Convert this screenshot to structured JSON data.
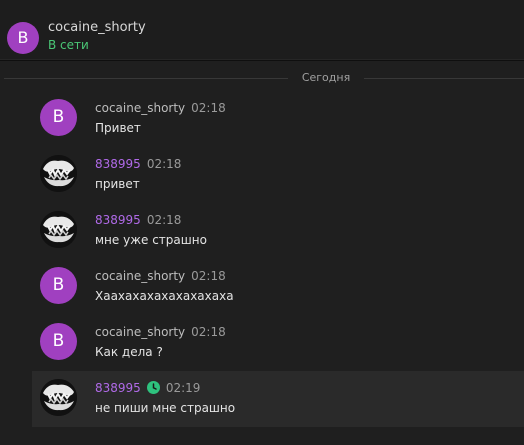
{
  "header": {
    "avatar_letter": "B",
    "name": "cocaine_shorty",
    "status": "В сети"
  },
  "date_separator": "Сегодня",
  "messages": [
    {
      "author": "cocaine_shorty",
      "avatar": "letter",
      "avatar_letter": "B",
      "time": "02:18",
      "text": "Привет"
    },
    {
      "author": "838995",
      "avatar": "picture",
      "time": "02:18",
      "text": "привет"
    },
    {
      "author": "838995",
      "avatar": "picture",
      "time": "02:18",
      "text": "мне уже страшно"
    },
    {
      "author": "cocaine_shorty",
      "avatar": "letter",
      "avatar_letter": "B",
      "time": "02:18",
      "text": "Хаахахахахахахахаха"
    },
    {
      "author": "cocaine_shorty",
      "avatar": "letter",
      "avatar_letter": "B",
      "time": "02:18",
      "text": "Как дела ?"
    },
    {
      "author": "838995",
      "avatar": "picture",
      "time": "02:19",
      "text": "не пиши мне страшно",
      "status_icon": "clock-icon"
    }
  ],
  "colors": {
    "avatar_purple": "#a040c0",
    "online_green": "#4ac776",
    "author_purple": "#b06ae8"
  }
}
